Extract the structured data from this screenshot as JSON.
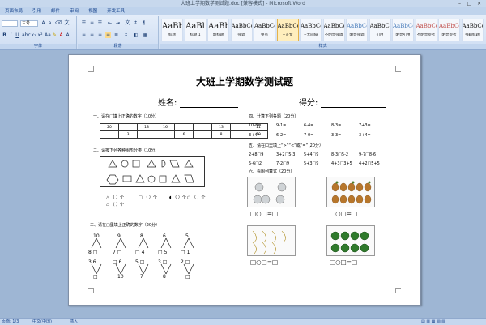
{
  "window": {
    "title": "大班上学期数学测试题.doc [兼容模式] - Microsoft Word"
  },
  "tabs": [
    "页面布局",
    "引用",
    "邮件",
    "审阅",
    "视图",
    "开发工具"
  ],
  "ribbon": {
    "font_name": "",
    "font_size": "三号",
    "group_font": "字体",
    "group_paragraph": "段落",
    "group_styles": "样式",
    "styles": [
      {
        "sample": "AaBbC",
        "name": "标题",
        "big": true
      },
      {
        "sample": "AaBl",
        "name": "标题 1",
        "big": true
      },
      {
        "sample": "AaBbC",
        "name": "副标题",
        "big": true
      },
      {
        "sample": "AaBbCcDt",
        "name": "强调",
        "big": false
      },
      {
        "sample": "AaBbCcD",
        "name": "要点",
        "big": false
      },
      {
        "sample": "AaBbCcDt",
        "name": "+正文",
        "big": false,
        "selected": true
      },
      {
        "sample": "AaBbCcDt",
        "name": "+无间隔",
        "big": false
      },
      {
        "sample": "AaBbCcDt",
        "name": "不明显强调",
        "big": false
      },
      {
        "sample": "AaBbCcDt",
        "name": "明显强调",
        "big": false
      },
      {
        "sample": "AaBbCcDt",
        "name": "引用",
        "big": false
      },
      {
        "sample": "AaBbCcDt",
        "name": "明显引用",
        "big": false
      },
      {
        "sample": "AaBbCcDt",
        "name": "不明显参考",
        "big": false
      },
      {
        "sample": "AaBbCcDt",
        "name": "明显参考",
        "big": false
      },
      {
        "sample": "AaBbCcI",
        "name": "书籍标题",
        "big": false
      }
    ]
  },
  "document": {
    "title": "大班上学期数学测试题",
    "name_label": "姓名:",
    "score_label": "得分:",
    "q1": "一、请在□填上正确的数字（10分）",
    "q1_table": [
      [
        "20",
        "",
        "18",
        "16",
        "",
        "",
        "13",
        "",
        "11"
      ],
      [
        "",
        "3",
        "",
        "",
        "6",
        "",
        "8",
        "",
        "10"
      ]
    ],
    "q2": "二、请按下列各种图形分类（10分）",
    "q2_counts": [
      "（  ）个",
      "（  ）个",
      "（  ）个",
      "（  ）个"
    ],
    "q3": "三、请在□里填上正确的数字（20分）",
    "q3_top": [
      "10",
      "9",
      "8",
      "6",
      "5"
    ],
    "q3_row2": [
      "8  □",
      "7  □",
      "□  4",
      "□  5",
      "□  1"
    ],
    "q3_row3": [
      "3  6",
      "□  6",
      "5  □",
      "3  □",
      "2  □"
    ],
    "q3_bottom": [
      "□",
      "10",
      "7",
      "8",
      "□"
    ],
    "q4": "四、计算下列各题（20分）",
    "q4_items": [
      "10-8=",
      "9-1=",
      "6-4=",
      "8-3=",
      "7+3=",
      "3+4=",
      "6-2=",
      "7-0=",
      "3-3=",
      "3+4="
    ],
    "q5": "五、请在口里填上“>”“<”或“=”（20分）",
    "q5_items": [
      "2+8□9",
      "3+2□5-3",
      "5+4□9",
      "8-3□5-2",
      "9-7□8-6",
      "5-6□2",
      "7-2□9",
      "5+3□9",
      "4+3□3+5",
      "4+2□5+5"
    ],
    "q6": "六、看图列算式（20分）",
    "q6_answers": [
      "□○□=□",
      "□○□=□",
      "□○□=□",
      "□○□=□"
    ]
  },
  "status": {
    "page": "页面: 1/3",
    "lang": "中文(中国)",
    "mode": "插入"
  }
}
